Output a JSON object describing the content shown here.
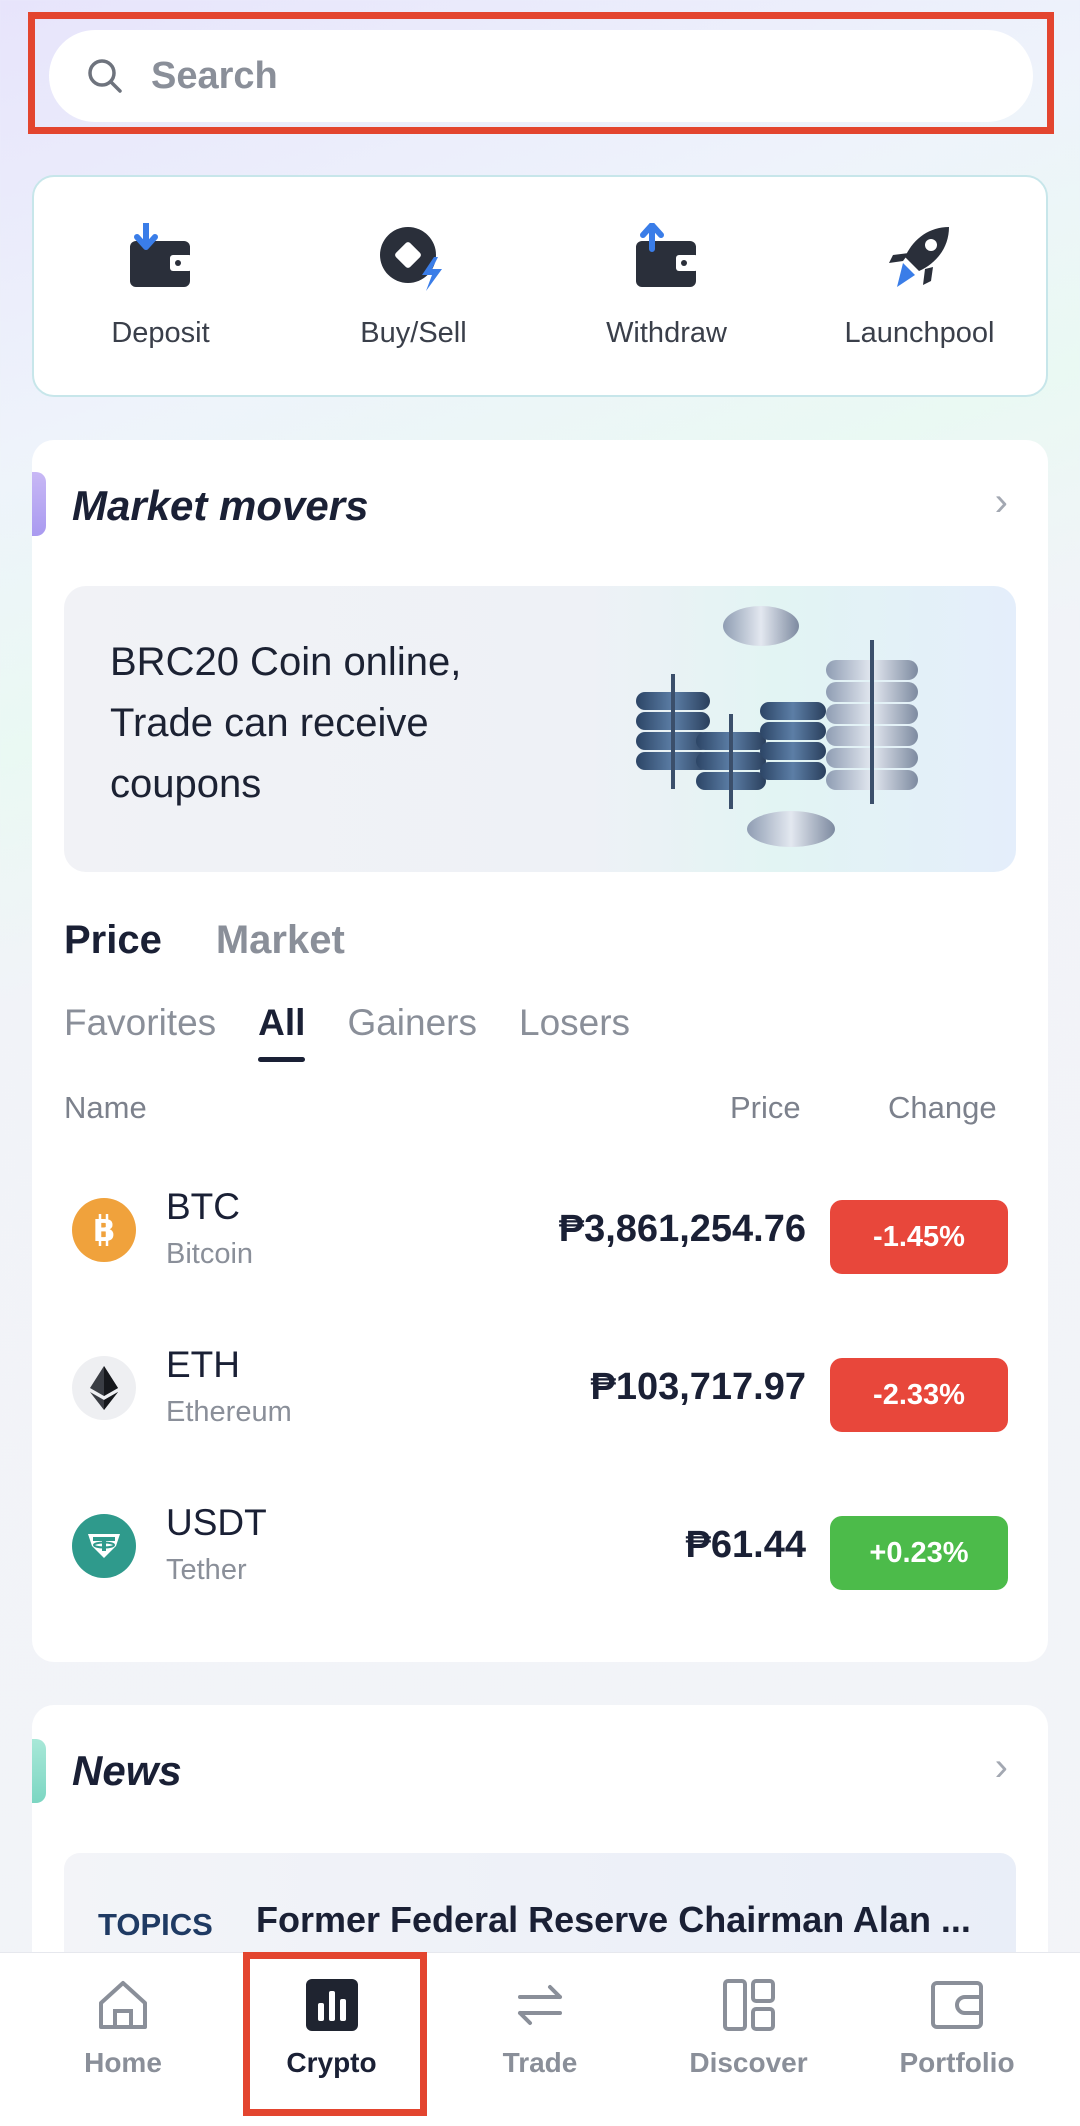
{
  "search": {
    "placeholder": "Search"
  },
  "shortcuts": [
    {
      "label": "Deposit",
      "icon": "deposit-wallet-icon"
    },
    {
      "label": "Buy/Sell",
      "icon": "buy-sell-coin-icon"
    },
    {
      "label": "Withdraw",
      "icon": "withdraw-wallet-icon"
    },
    {
      "label": "Launchpool",
      "icon": "rocket-icon"
    }
  ],
  "market_movers": {
    "title": "Market movers",
    "banner_text": "BRC20 Coin online, Trade can receive coupons",
    "main_tabs": [
      "Price",
      "Market"
    ],
    "sub_tabs": [
      "Favorites",
      "All",
      "Gainers",
      "Losers"
    ],
    "columns": {
      "name": "Name",
      "price": "Price",
      "change": "Change"
    },
    "rows": [
      {
        "symbol": "BTC",
        "name": "Bitcoin",
        "price": "₱3,861,254.76",
        "change": "-1.45%",
        "trend": "down"
      },
      {
        "symbol": "ETH",
        "name": "Ethereum",
        "price": "₱103,717.97",
        "change": "-2.33%",
        "trend": "down"
      },
      {
        "symbol": "USDT",
        "name": "Tether",
        "price": "₱61.44",
        "change": "+0.23%",
        "trend": "up"
      }
    ]
  },
  "news": {
    "title": "News",
    "items": [
      {
        "tag": "TOPICS",
        "headline": "Former Federal Reserve Chairman Alan ..."
      }
    ]
  },
  "bottom_nav": [
    {
      "label": "Home",
      "icon": "home-icon"
    },
    {
      "label": "Crypto",
      "icon": "bar-chart-icon",
      "active": true
    },
    {
      "label": "Trade",
      "icon": "swap-arrows-icon"
    },
    {
      "label": "Discover",
      "icon": "grid-icon"
    },
    {
      "label": "Portfolio",
      "icon": "wallet-icon"
    }
  ],
  "colors": {
    "down": "#e8473b",
    "up": "#4cbb4a",
    "highlight": "#e3452f",
    "accent_blue": "#3a7de8"
  }
}
